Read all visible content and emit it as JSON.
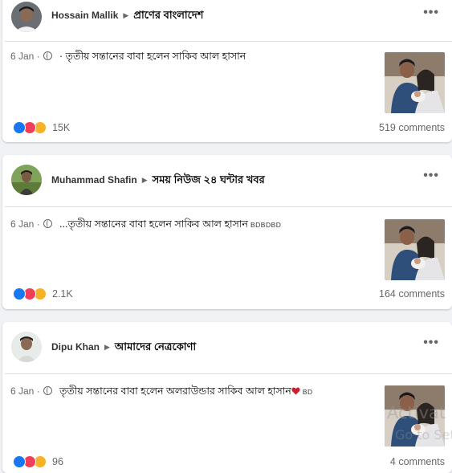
{
  "posts": [
    {
      "author": "Hossain Mallik",
      "group": "প্রাণের বাংলাদেশ",
      "date": "6 Jan",
      "separator": "·",
      "text": "· তৃতীয় সন্তানের বাবা হলেন সাকিব আল হাসান",
      "suffix": "",
      "reaction_count": "15K",
      "comments": "519 comments",
      "reactions": [
        "like-icon",
        "love-icon",
        "haha-icon"
      ]
    },
    {
      "author": "Muhammad Shafin",
      "group": "সময় নিউজ ২৪ ঘন্টার খবর",
      "date": "6 Jan",
      "separator": "·",
      "text": "...তৃতীয় সন্তানের বাবা হলেন সাকিব আল হাসান",
      "suffix": "BDBDBD",
      "reaction_count": "2.1K",
      "comments": "164 comments",
      "reactions": [
        "like-icon",
        "love-icon",
        "wow-icon"
      ]
    },
    {
      "author": "Dipu Khan",
      "group": "আমাদের নেত্রকোণা",
      "date": "6 Jan",
      "separator": "·",
      "text": "তৃতীয় সন্তানের বাবা হলেন অলরাউন্ডার সাকিব আল হাসান",
      "suffix": "BD",
      "reaction_count": "96",
      "comments": "4 comments",
      "reactions": [
        "like-icon",
        "love-icon",
        "care-icon"
      ]
    }
  ],
  "more_label": "•••",
  "watermark": {
    "line1": "Activat",
    "line2": "Go to Set"
  },
  "colors": {
    "like": "#1877f2",
    "love": "#f33e58",
    "haha": "#f7b125",
    "meta": "#65676b"
  }
}
